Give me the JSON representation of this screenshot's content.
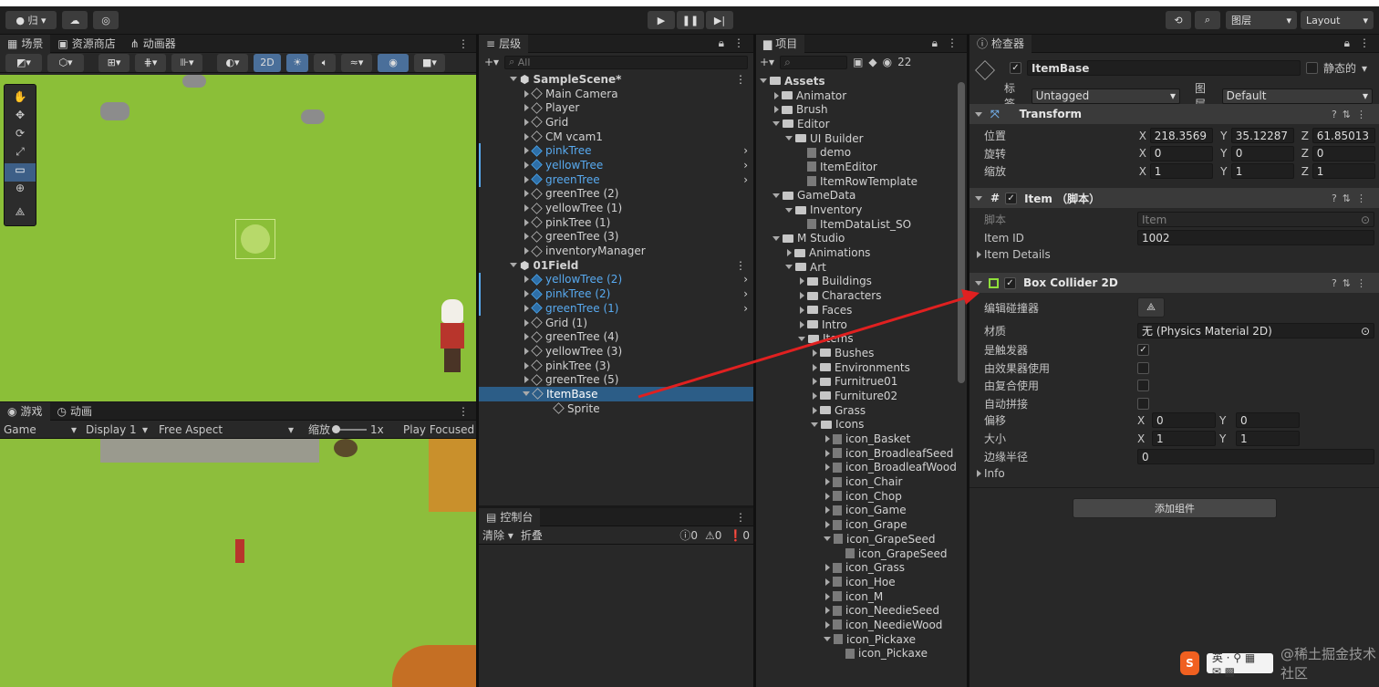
{
  "toolbar": {
    "account": "归",
    "layers": "图层",
    "layout": "Layout"
  },
  "scene": {
    "tab_scene": "场景",
    "tab_store": "资源商店",
    "tab_animator": "动画器",
    "mode_2d": "2D"
  },
  "game": {
    "tab_game": "游戏",
    "tab_anim": "动画",
    "display_mode": "Game",
    "display": "Display 1",
    "aspect": "Free Aspect",
    "scale_label": "缩放",
    "scale_value": "1x",
    "play_focused": "Play Focused"
  },
  "hierarchy": {
    "tab": "层级",
    "search_placeholder": "All",
    "items": [
      {
        "label": "SampleScene*",
        "depth": 0,
        "kind": "scene",
        "color": "normal"
      },
      {
        "label": "Main Camera",
        "depth": 1,
        "kind": "obj",
        "color": "normal"
      },
      {
        "label": "Player",
        "depth": 1,
        "kind": "obj",
        "color": "normal"
      },
      {
        "label": "Grid",
        "depth": 1,
        "kind": "obj",
        "color": "normal"
      },
      {
        "label": "CM vcam1",
        "depth": 1,
        "kind": "obj",
        "color": "normal"
      },
      {
        "label": "pinkTree",
        "depth": 1,
        "kind": "prefab",
        "color": "blue"
      },
      {
        "label": "yellowTree",
        "depth": 1,
        "kind": "prefab",
        "color": "blue"
      },
      {
        "label": "greenTree",
        "depth": 1,
        "kind": "prefab",
        "color": "blue"
      },
      {
        "label": "greenTree (2)",
        "depth": 1,
        "kind": "obj",
        "color": "normal"
      },
      {
        "label": "yellowTree (1)",
        "depth": 1,
        "kind": "obj",
        "color": "normal"
      },
      {
        "label": "pinkTree (1)",
        "depth": 1,
        "kind": "obj",
        "color": "normal"
      },
      {
        "label": "greenTree (3)",
        "depth": 1,
        "kind": "obj",
        "color": "normal"
      },
      {
        "label": "inventoryManager",
        "depth": 1,
        "kind": "obj",
        "color": "normal"
      },
      {
        "label": "01Field",
        "depth": 0,
        "kind": "scene",
        "color": "normal"
      },
      {
        "label": "yellowTree (2)",
        "depth": 1,
        "kind": "prefab",
        "color": "blue"
      },
      {
        "label": "pinkTree (2)",
        "depth": 1,
        "kind": "prefab",
        "color": "blue"
      },
      {
        "label": "greenTree (1)",
        "depth": 1,
        "kind": "prefab",
        "color": "blue"
      },
      {
        "label": "Grid (1)",
        "depth": 1,
        "kind": "obj",
        "color": "normal"
      },
      {
        "label": "greenTree (4)",
        "depth": 1,
        "kind": "obj",
        "color": "normal"
      },
      {
        "label": "yellowTree (3)",
        "depth": 1,
        "kind": "obj",
        "color": "normal"
      },
      {
        "label": "pinkTree (3)",
        "depth": 1,
        "kind": "obj",
        "color": "normal"
      },
      {
        "label": "greenTree (5)",
        "depth": 1,
        "kind": "obj",
        "color": "normal"
      },
      {
        "label": "ItemBase",
        "depth": 1,
        "kind": "obj",
        "color": "selected"
      },
      {
        "label": "Sprite",
        "depth": 2,
        "kind": "obj",
        "color": "normal"
      }
    ]
  },
  "console": {
    "tab": "控制台",
    "clear": "清除",
    "collapse": "折叠",
    "info_count": "0",
    "warn_count": "0",
    "error_count": "0"
  },
  "project": {
    "tab": "项目",
    "badge": "22",
    "items": [
      {
        "label": "Assets",
        "depth": 0,
        "kind": "root"
      },
      {
        "label": "Animator",
        "depth": 1,
        "kind": "folder"
      },
      {
        "label": "Brush",
        "depth": 1,
        "kind": "folder"
      },
      {
        "label": "Editor",
        "depth": 1,
        "kind": "folder"
      },
      {
        "label": "UI Builder",
        "depth": 2,
        "kind": "folder"
      },
      {
        "label": "demo",
        "depth": 3,
        "kind": "file"
      },
      {
        "label": "ItemEditor",
        "depth": 3,
        "kind": "file"
      },
      {
        "label": "ItemRowTemplate",
        "depth": 3,
        "kind": "file"
      },
      {
        "label": "GameData",
        "depth": 1,
        "kind": "folder"
      },
      {
        "label": "Inventory",
        "depth": 2,
        "kind": "folder"
      },
      {
        "label": "ItemDataList_SO",
        "depth": 3,
        "kind": "file"
      },
      {
        "label": "M Studio",
        "depth": 1,
        "kind": "folder"
      },
      {
        "label": "Animations",
        "depth": 2,
        "kind": "folder"
      },
      {
        "label": "Art",
        "depth": 2,
        "kind": "folder"
      },
      {
        "label": "Buildings",
        "depth": 3,
        "kind": "folder"
      },
      {
        "label": "Characters",
        "depth": 3,
        "kind": "folder"
      },
      {
        "label": "Faces",
        "depth": 3,
        "kind": "folder"
      },
      {
        "label": "Intro",
        "depth": 3,
        "kind": "folder"
      },
      {
        "label": "Items",
        "depth": 3,
        "kind": "folder"
      },
      {
        "label": "Bushes",
        "depth": 4,
        "kind": "folder"
      },
      {
        "label": "Environments",
        "depth": 4,
        "kind": "folder"
      },
      {
        "label": "Furnitrue01",
        "depth": 4,
        "kind": "folder"
      },
      {
        "label": "Furniture02",
        "depth": 4,
        "kind": "folder"
      },
      {
        "label": "Grass",
        "depth": 4,
        "kind": "folder"
      },
      {
        "label": "Icons",
        "depth": 4,
        "kind": "folder"
      },
      {
        "label": "icon_Basket",
        "depth": 5,
        "kind": "file"
      },
      {
        "label": "icon_BroadleafSeed",
        "depth": 5,
        "kind": "file"
      },
      {
        "label": "icon_BroadleafWood",
        "depth": 5,
        "kind": "file"
      },
      {
        "label": "icon_Chair",
        "depth": 5,
        "kind": "file"
      },
      {
        "label": "icon_Chop",
        "depth": 5,
        "kind": "file"
      },
      {
        "label": "icon_Game",
        "depth": 5,
        "kind": "file"
      },
      {
        "label": "icon_Grape",
        "depth": 5,
        "kind": "file"
      },
      {
        "label": "icon_GrapeSeed",
        "depth": 5,
        "kind": "file"
      },
      {
        "label": "icon_GrapeSeed",
        "depth": 6,
        "kind": "file"
      },
      {
        "label": "icon_Grass",
        "depth": 5,
        "kind": "file"
      },
      {
        "label": "icon_Hoe",
        "depth": 5,
        "kind": "file"
      },
      {
        "label": "icon_M",
        "depth": 5,
        "kind": "file"
      },
      {
        "label": "icon_NeedieSeed",
        "depth": 5,
        "kind": "file"
      },
      {
        "label": "icon_NeedieWood",
        "depth": 5,
        "kind": "file"
      },
      {
        "label": "icon_Pickaxe",
        "depth": 5,
        "kind": "file"
      },
      {
        "label": "icon_Pickaxe",
        "depth": 6,
        "kind": "file"
      }
    ]
  },
  "inspector": {
    "tab": "检查器",
    "object_name": "ItemBase",
    "static_label": "静态的",
    "tag_label": "标签",
    "tag_value": "Untagged",
    "layer_label": "图层",
    "layer_value": "Default",
    "transform": {
      "title": "Transform",
      "position": "位置",
      "rotation": "旋转",
      "scale": "缩放",
      "pos": {
        "x": "218.3569",
        "y": "35.12287",
        "z": "61.85013"
      },
      "rot": {
        "x": "0",
        "y": "0",
        "z": "0"
      },
      "scl": {
        "x": "1",
        "y": "1",
        "z": "1"
      }
    },
    "item": {
      "title": "Item （脚本）",
      "script_label": "脚本",
      "script_value": "Item",
      "id_label": "Item ID",
      "id_value": "1002",
      "details": "Item Details"
    },
    "collider": {
      "title": "Box Collider 2D",
      "edit": "编辑碰撞器",
      "material_label": "材质",
      "material_value": "无 (Physics Material 2D)",
      "trigger": "是触发器",
      "used_by_effector": "由效果器使用",
      "used_by_composite": "由复合使用",
      "auto_tiling": "自动拼接",
      "offset": "偏移",
      "offset_x": "0",
      "offset_y": "0",
      "size": "大小",
      "size_x": "1",
      "size_y": "1",
      "edge_radius": "边缘半径",
      "edge_value": "0",
      "info": "Info"
    },
    "add_component": "添加组件"
  },
  "axes": {
    "x": "X",
    "y": "Y",
    "z": "Z"
  },
  "watermark": "@稀土掘金技术社区",
  "colors": {
    "selected": "#2c5d87",
    "blue_text": "#58aaf0",
    "arrow": "#e02020"
  }
}
